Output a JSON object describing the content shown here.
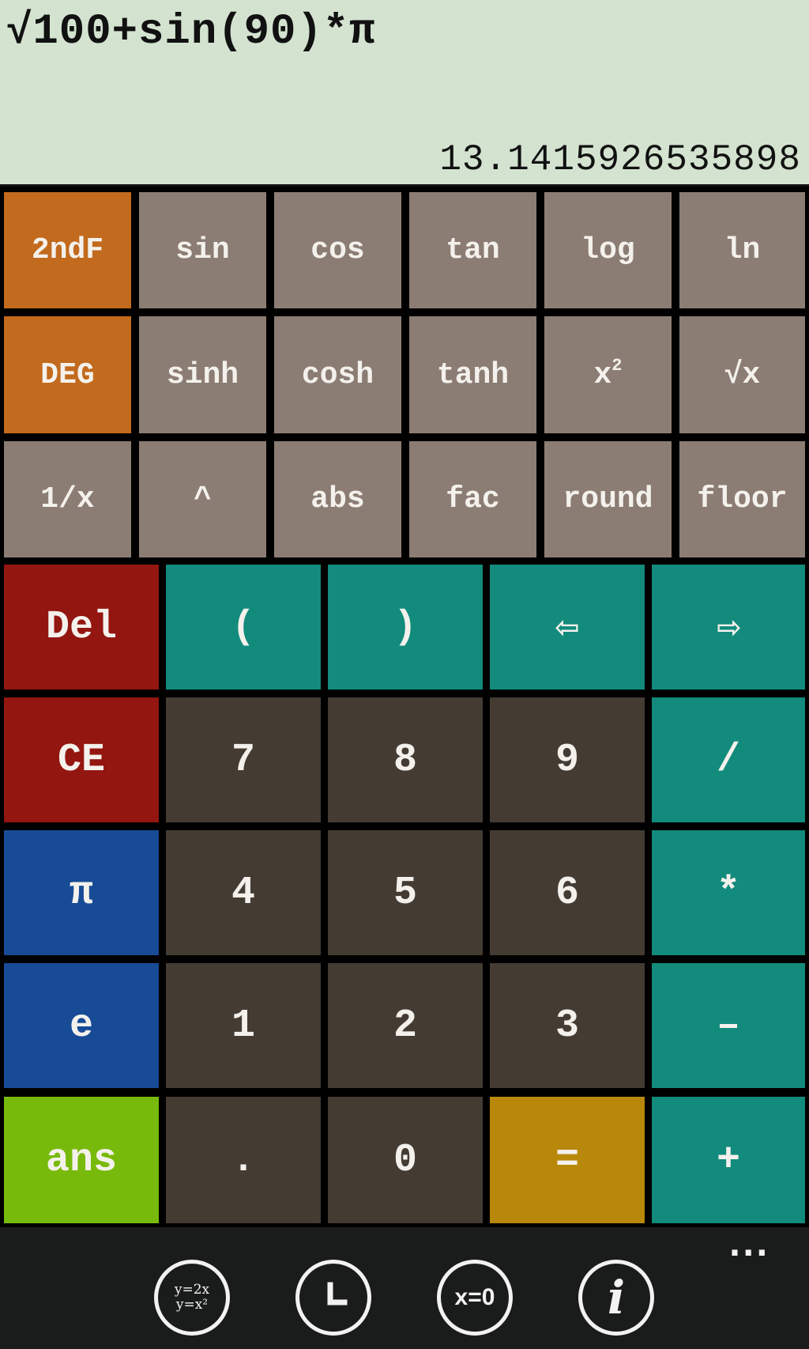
{
  "display": {
    "expression": "√100+sin(90)*π",
    "result": "13.1415926535898"
  },
  "keys": {
    "second_f": "2ndF",
    "sin": "sin",
    "cos": "cos",
    "tan": "tan",
    "log": "log",
    "ln": "ln",
    "deg": "DEG",
    "sinh": "sinh",
    "cosh": "cosh",
    "tanh": "tanh",
    "square_base": "x",
    "square_exp": "2",
    "sqrt": "√x",
    "reciprocal": "1/x",
    "power": "^",
    "abs": "abs",
    "fac": "fac",
    "round": "round",
    "floor": "floor",
    "del": "Del",
    "open_paren": "(",
    "close_paren": ")",
    "cursor_left": "⇦",
    "cursor_right": "⇨",
    "ce": "CE",
    "seven": "7",
    "eight": "8",
    "nine": "9",
    "divide": "/",
    "pi": "π",
    "four": "4",
    "five": "5",
    "six": "6",
    "multiply": "*",
    "e": "e",
    "one": "1",
    "two": "2",
    "three": "3",
    "minus": "–",
    "ans": "ans",
    "dot": ".",
    "zero": "0",
    "equals": "=",
    "plus": "+"
  },
  "appbar": {
    "graph_line1": "y=2x",
    "graph_line2": "y=x²",
    "solve_label": "x=0",
    "info_label": "i",
    "more": "..."
  },
  "colors": {
    "display_bg": "#d3e3d0",
    "scientific_key": "#8c7d74",
    "mode_key": "#c26a1e",
    "number_key": "#443b33",
    "operator_key": "#128b7c",
    "delete_key": "#931611",
    "constant_key": "#174b96",
    "ans_key": "#78ba0b",
    "equals_key": "#b8880a",
    "appbar_bg": "#1a1c1b"
  },
  "icons": {
    "graph": "graph-icon",
    "history": "clock-icon",
    "solver": "equation-solver-icon",
    "info": "info-icon",
    "more": "more-dots-icon"
  }
}
